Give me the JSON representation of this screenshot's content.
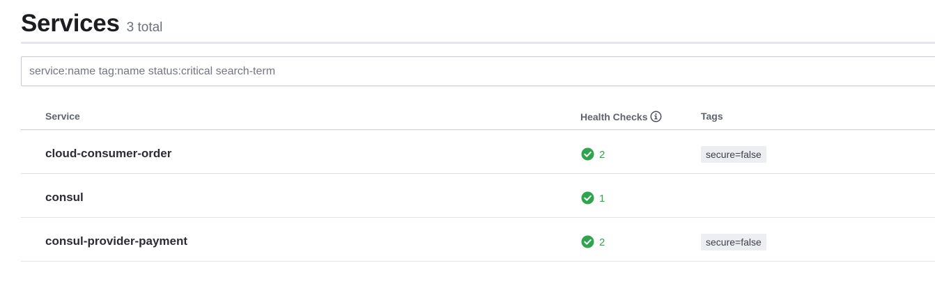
{
  "header": {
    "title": "Services",
    "count": "3 total"
  },
  "search": {
    "placeholder": "service:name tag:name status:critical search-term",
    "value": ""
  },
  "table": {
    "columns": {
      "service": "Service",
      "health": "Health Checks",
      "tags": "Tags"
    },
    "rows": [
      {
        "name": "cloud-consumer-order",
        "health_passing": "2",
        "tag": "secure=false"
      },
      {
        "name": "consul",
        "health_passing": "1",
        "tag": ""
      },
      {
        "name": "consul-provider-payment",
        "health_passing": "2",
        "tag": "secure=false"
      }
    ]
  },
  "icons": {
    "health_info": "info-circle-icon",
    "health_passing": "check-circle-icon"
  },
  "colors": {
    "passing": "#2ea44f",
    "tag_background": "#eceef2"
  }
}
